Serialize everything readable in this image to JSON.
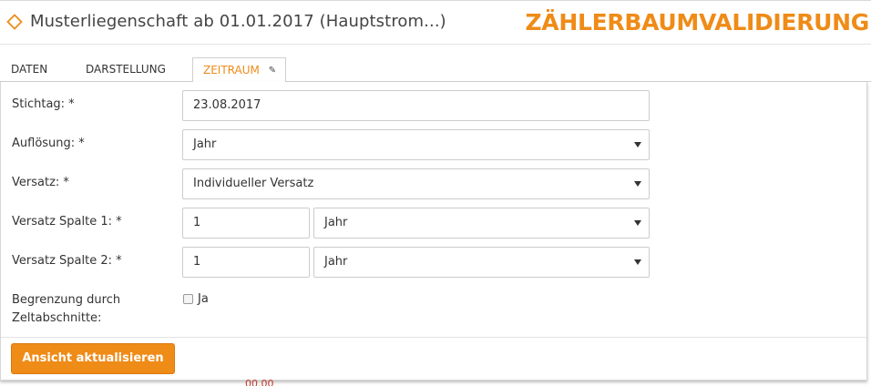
{
  "header": {
    "title": "Musterliegenschaft ab 01.01.2017 (Hauptstrom...)",
    "icon": "diamond-outline-icon",
    "brand": "ZÄHLERBAUMVALIDIERUNG",
    "brand_color": "#ef8b17"
  },
  "tabs": [
    {
      "label": "DATEN",
      "active": false
    },
    {
      "label": "DARSTELLUNG",
      "active": false
    },
    {
      "label": "ZEITRAUM",
      "active": true,
      "icon": "pencil-icon"
    }
  ],
  "form": {
    "stichtag": {
      "label": "Stichtag: *",
      "value": "23.08.2017"
    },
    "aufloesung": {
      "label": "Auflösung: *",
      "value": "Jahr"
    },
    "versatz": {
      "label": "Versatz: *",
      "value": "Individueller Versatz"
    },
    "versatz_spalte_1": {
      "label": "Versatz Spalte 1: *",
      "number": "1",
      "unit": "Jahr"
    },
    "versatz_spalte_2": {
      "label": "Versatz Spalte 2: *",
      "number": "1",
      "unit": "Jahr"
    },
    "begrenzung": {
      "label_line1": "Begrenzung durch",
      "label_line2": "Zeltabschnitte:",
      "checkbox_label": "Ja",
      "checked": false
    }
  },
  "actions": {
    "update_label": "Ansicht aktualisieren"
  },
  "background_text": "00.00"
}
